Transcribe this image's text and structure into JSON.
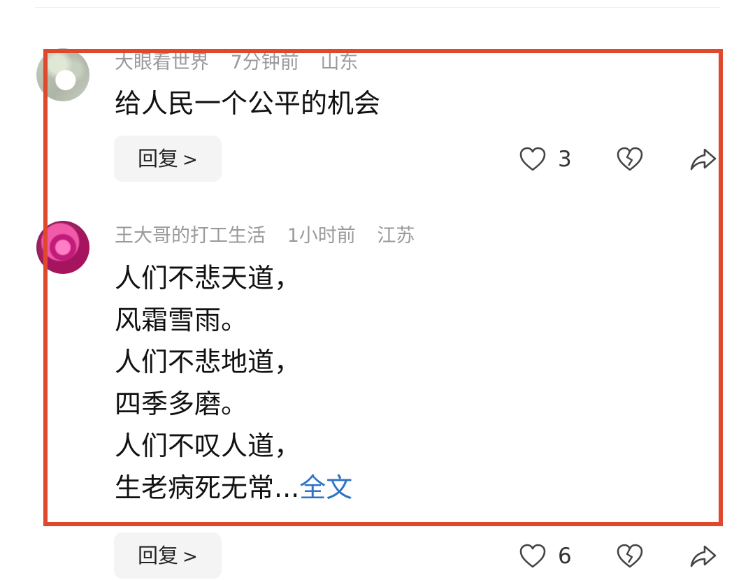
{
  "comments": [
    {
      "username": "大眼看世界",
      "time": "7分钟前",
      "location": "山东",
      "text_lines": [
        "给人民一个公平的机会"
      ],
      "reply_label": "回复",
      "like_count": "3",
      "icons": {
        "like": "heart-icon",
        "dislike": "broken-heart-icon",
        "share": "share-icon"
      }
    },
    {
      "username": "王大哥的打工生活",
      "time": "1小时前",
      "location": "江苏",
      "text_lines": [
        "人们不悲天道，",
        "风霜雪雨。",
        "人们不悲地道，",
        "四季多磨。",
        "人们不叹人道，",
        "生老病死无常..."
      ],
      "more_label": "全文",
      "reply_label": "回复",
      "like_count": "6",
      "icons": {
        "like": "heart-icon",
        "dislike": "broken-heart-icon",
        "share": "share-icon"
      }
    }
  ],
  "colors": {
    "highlight_border": "#e0482e",
    "link": "#2f73c5",
    "meta_text": "#9a9a9a"
  }
}
